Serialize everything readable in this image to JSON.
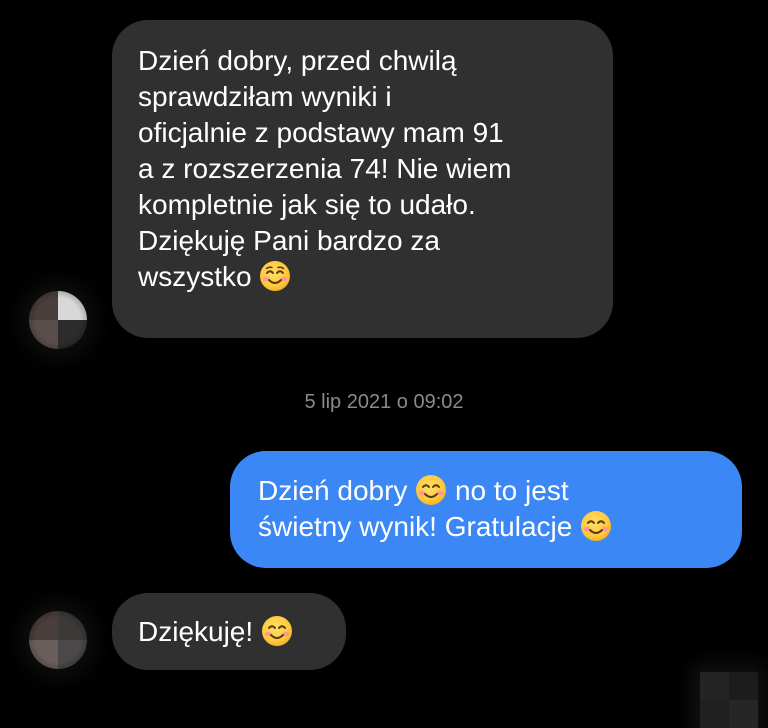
{
  "conversation": {
    "messages": [
      {
        "direction": "incoming",
        "lines": [
          "Dzień dobry, przed chwilą",
          "sprawdziłam wyniki i",
          "oficjalnie z podstawy mam 91",
          "a z rozszerzenia 74! Nie wiem",
          "kompletnie jak się to udało.",
          "Dziękuję Pani bardzo za",
          "wszystko"
        ],
        "trailing_emoji": "smiling-face-icon"
      },
      {
        "direction": "outgoing",
        "line1_before_emoji": "Dzień dobry",
        "line1_after_emoji": "no to jest",
        "line2": "świetny wynik! Gratulacje"
      },
      {
        "direction": "incoming",
        "text": "Dziękuję!"
      }
    ],
    "timestamp": "5 lip 2021 o 09:02"
  },
  "colors": {
    "background": "#000000",
    "incoming_bubble": "#303030",
    "outgoing_bubble": "#3b87f5",
    "timestamp_text": "#8a8a8a",
    "emoji_face": "#ffc83d"
  }
}
